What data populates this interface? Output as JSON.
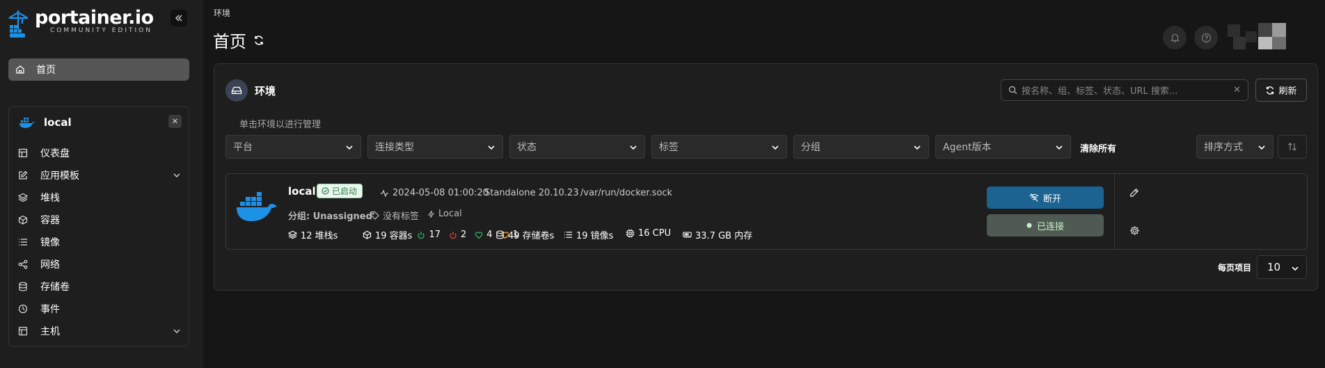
{
  "app": {
    "logo_title": "portainer.io",
    "logo_subtitle": "COMMUNITY EDITION"
  },
  "sidebar": {
    "home_label": "首页",
    "environment": {
      "name": "local",
      "items": [
        {
          "label": "仪表盘",
          "icon": "dashboard-icon"
        },
        {
          "label": "应用模板",
          "icon": "edit-icon",
          "expandable": true
        },
        {
          "label": "堆栈",
          "icon": "layers-icon"
        },
        {
          "label": "容器",
          "icon": "box-icon"
        },
        {
          "label": "镜像",
          "icon": "list-icon"
        },
        {
          "label": "网络",
          "icon": "share-icon"
        },
        {
          "label": "存储卷",
          "icon": "database-icon"
        },
        {
          "label": "事件",
          "icon": "clock-icon"
        },
        {
          "label": "主机",
          "icon": "host-icon",
          "expandable": true
        }
      ]
    }
  },
  "header": {
    "breadcrumb": "环境",
    "title": "首页"
  },
  "panel": {
    "title": "环境",
    "search_placeholder": "按名称、组、标签、状态、URL 搜索...",
    "refresh_label": "刷新",
    "hint": "单击环境以进行管理",
    "filters": [
      "平台",
      "连接类型",
      "状态",
      "标签",
      "分组",
      "Agent版本"
    ],
    "clear_all": "清除所有",
    "sort_label": "排序方式",
    "per_page_label": "每页项目",
    "per_page_value": "10"
  },
  "environments": [
    {
      "name": "local",
      "status": "已启动",
      "timestamp": "2024-05-08 01:00:20",
      "type": "Standalone 20.10.23",
      "url": "/var/run/docker.sock",
      "group": "分组: Unassigned",
      "tags": "没有标签",
      "location": "Local",
      "stacks": "12 堆栈s",
      "containers": "19 容器s",
      "running": "17",
      "stopped": "2",
      "healthy": "4",
      "unhealthy": "1",
      "volumes": "49 存储卷s",
      "images": "19 镜像s",
      "cpu": "16 CPU",
      "memory": "33.7 GB 内存",
      "disconnect_label": "断开",
      "connected_label": "已连接"
    }
  ],
  "colors": {
    "accent_blue": "#1d6392",
    "docker_blue": "#1d91e6",
    "success": "#2f7d4a"
  }
}
